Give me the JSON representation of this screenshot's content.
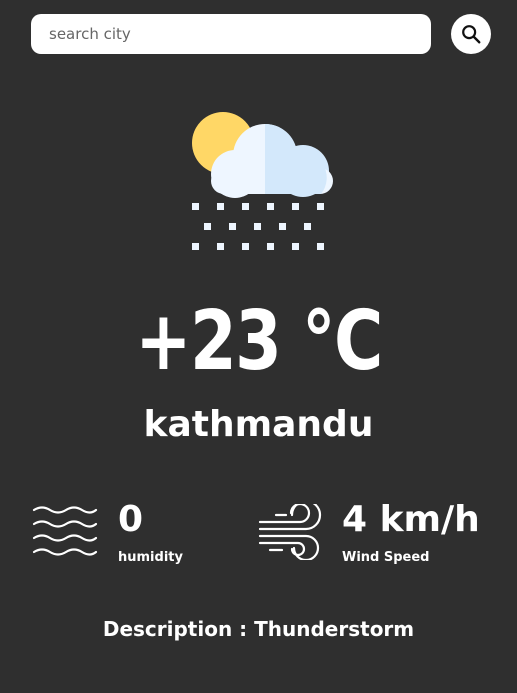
{
  "search": {
    "placeholder": "search city",
    "value": ""
  },
  "weather": {
    "icon": "sun-cloud-snow-icon",
    "temperature": "+23 °C",
    "city": "kathmandu",
    "humidity_value": "0",
    "humidity_label": "humidity",
    "wind_value": "4 km/h",
    "wind_label": "Wind Speed",
    "description": "Description : Thunderstorm"
  },
  "colors": {
    "background": "#2f2f2f",
    "text": "#ffffff",
    "sun": "#ffd766",
    "cloud_light": "#eef6ff",
    "cloud_shade": "#d3e8fb"
  }
}
